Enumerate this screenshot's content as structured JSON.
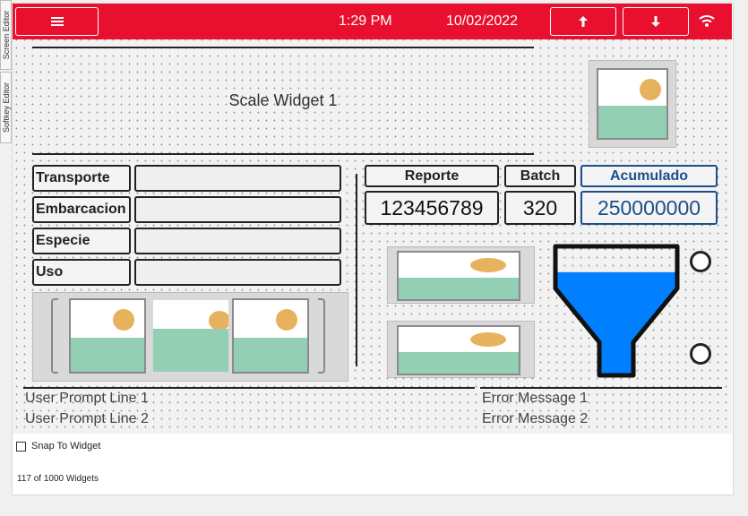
{
  "side_tabs": [
    "Screen Editor",
    "Softkey Editor"
  ],
  "topbar": {
    "menu_icon": "hamburger-icon",
    "time": "1:29 PM",
    "date": "10/02/2022",
    "up_icon": "arrow-up-icon",
    "down_icon": "arrow-down-icon",
    "wifi_icon": "wifi-icon",
    "bg_color": "#e8102e"
  },
  "scale_widget": {
    "label": "Scale Widget 1"
  },
  "fields": [
    {
      "label": "Transporte",
      "value": ""
    },
    {
      "label": "Embarcacion",
      "value": ""
    },
    {
      "label": "Especie",
      "value": ""
    },
    {
      "label": "Uso",
      "value": ""
    }
  ],
  "readouts": {
    "reporte": {
      "label": "Reporte",
      "value": "123456789"
    },
    "batch": {
      "label": "Batch",
      "value": "320"
    },
    "acumulado": {
      "label": "Acumulado",
      "value": "250000000",
      "color": "#1b4f8a"
    }
  },
  "hopper": {
    "fill_color": "#0080ff",
    "fill_level": 0.8
  },
  "prompts": [
    "User Prompt Line 1",
    "User Prompt Line 2"
  ],
  "errors": [
    "Error Message 1",
    "Error Message 2"
  ],
  "footer": {
    "snap_label": "Snap To Widget",
    "widget_count": "117 of 1000 Widgets"
  }
}
